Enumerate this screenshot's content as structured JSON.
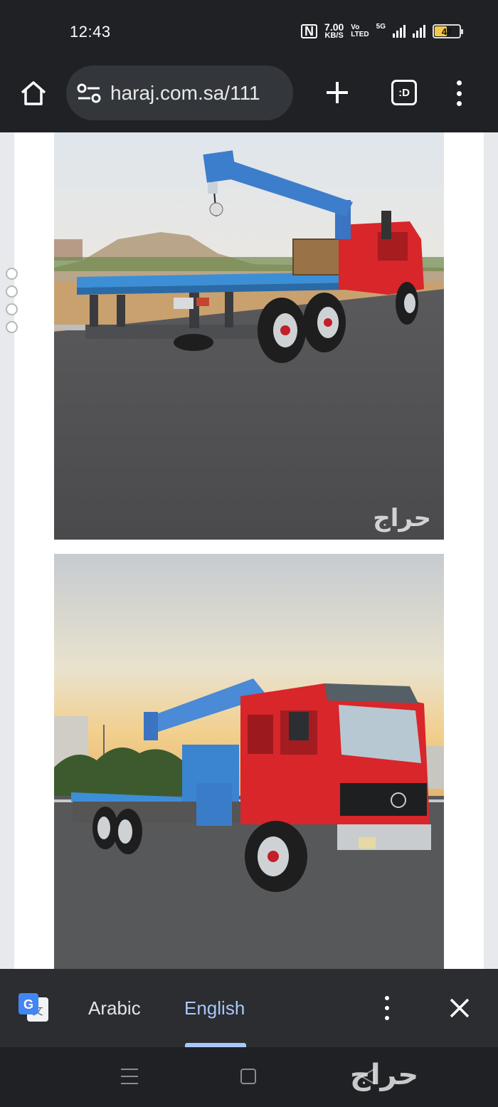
{
  "status_bar": {
    "time": "12:43",
    "nfc": "N",
    "net_speed_value": "7.00",
    "net_speed_unit": "KB/S",
    "volte_top": "Vo",
    "volte_bottom": "LTED",
    "network_type": "5G",
    "battery_level": "47"
  },
  "browser": {
    "url": "haraj.com.sa/111",
    "tabs_label": ":D",
    "icons": [
      "home-icon",
      "site-settings-icon",
      "new-tab-icon",
      "tab-switcher-icon",
      "overflow-menu-icon"
    ]
  },
  "content": {
    "photos": [
      {
        "subject": "blue-and-red-crane-truck-rear-view",
        "watermark": "حراج"
      },
      {
        "subject": "red-crane-truck-front-view",
        "watermark": ""
      }
    ]
  },
  "translate_bar": {
    "source_language": "Arabic",
    "target_language": "English",
    "selected": "English"
  },
  "nav_bar": {
    "watermark": "حراج"
  },
  "colors": {
    "background": "#1f2125",
    "url_box": "#33363b",
    "accent": "#a8c7fa",
    "translate_bar": "#2b2d31"
  }
}
